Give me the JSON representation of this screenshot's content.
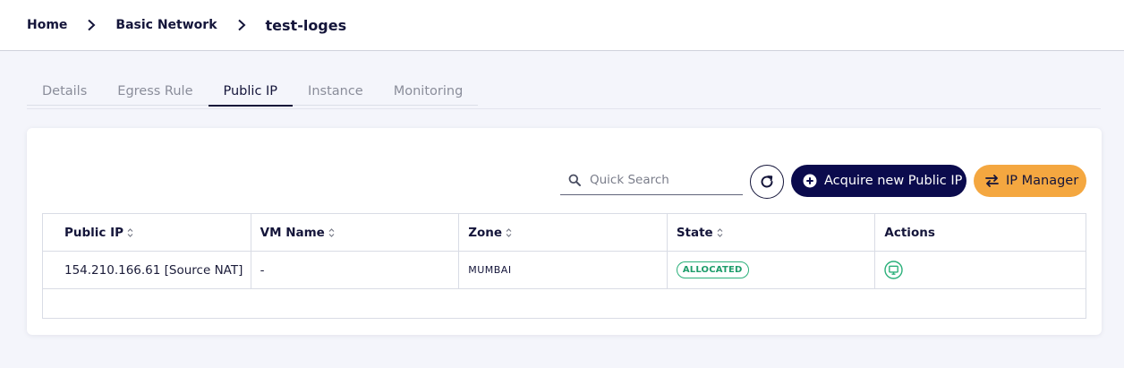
{
  "breadcrumb": {
    "home": "Home",
    "network": "Basic Network",
    "current": "test-loges"
  },
  "tabs": [
    {
      "label": "Details",
      "active": false
    },
    {
      "label": "Egress Rule",
      "active": false
    },
    {
      "label": "Public IP",
      "active": true
    },
    {
      "label": "Instance",
      "active": false
    },
    {
      "label": "Monitoring",
      "active": false
    }
  ],
  "toolbar": {
    "search_placeholder": "Quick Search",
    "acquire_label": "Acquire new Public IP",
    "ip_manager_label": "IP Manager"
  },
  "table": {
    "columns": [
      "Public IP",
      "VM Name",
      "Zone",
      "State",
      "Actions"
    ],
    "rows": [
      {
        "public_ip": "154.210.166.61 [Source NAT]",
        "vm_name": "-",
        "zone": "MUMBAI",
        "state": "ALLOCATED"
      }
    ]
  },
  "colors": {
    "primary": "#0b0b4d",
    "accent_orange": "#f4a740",
    "status_green": "#2bb07a",
    "background": "#f4f5fb"
  },
  "icons": {
    "breadcrumb_separator": "chevron-right-icon",
    "search": "search-icon",
    "refresh": "refresh-icon",
    "acquire": "plus-circle-icon",
    "ip_manager": "swap-arrows-icon",
    "sort": "sort-icon",
    "action": "monitor-icon"
  }
}
